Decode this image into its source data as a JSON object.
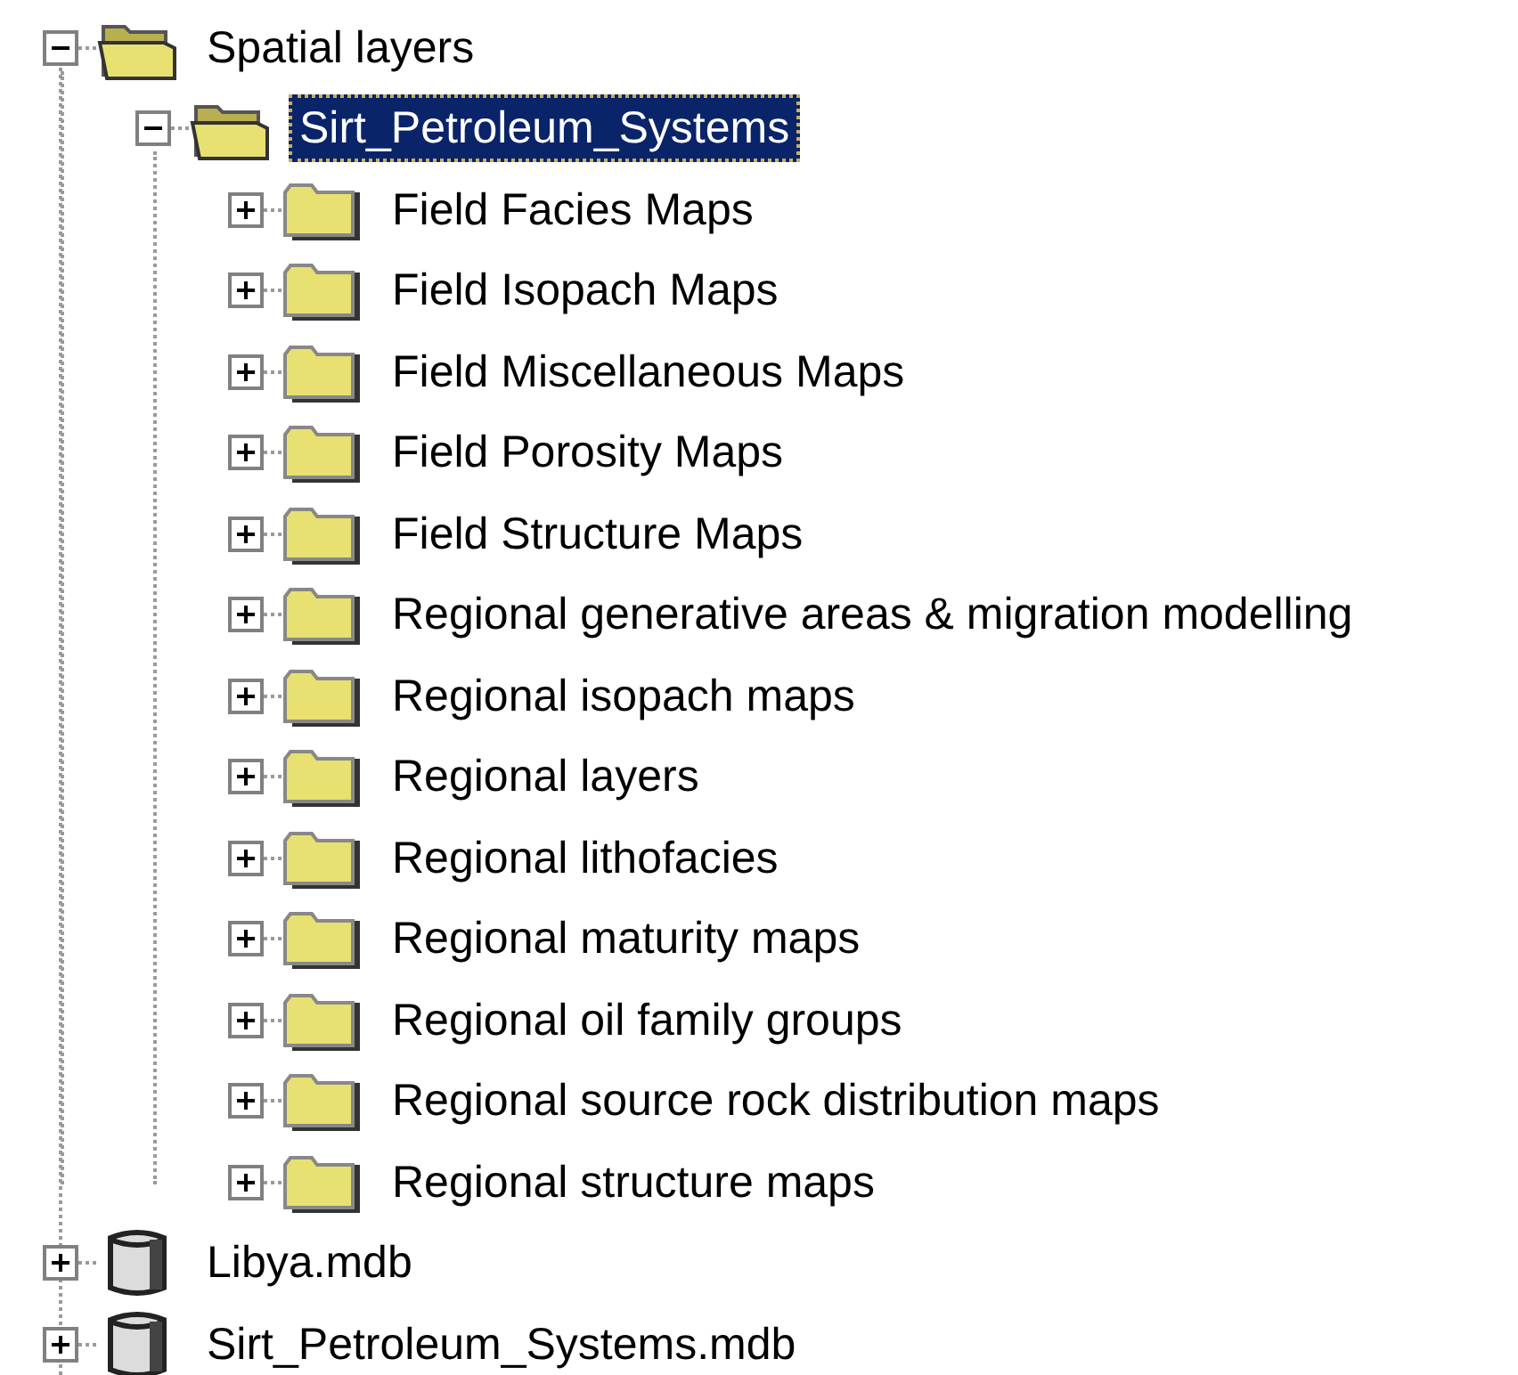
{
  "tree": [
    {
      "label": "Spatial layers",
      "kind": "folder",
      "expanded": true,
      "selected": false,
      "children": [
        {
          "label": "Sirt_Petroleum_Systems",
          "kind": "folder",
          "expanded": true,
          "selected": true,
          "children": [
            {
              "label": "Field Facies Maps",
              "kind": "folder",
              "expanded": false,
              "selected": false
            },
            {
              "label": "Field Isopach Maps",
              "kind": "folder",
              "expanded": false,
              "selected": false
            },
            {
              "label": "Field Miscellaneous Maps",
              "kind": "folder",
              "expanded": false,
              "selected": false
            },
            {
              "label": "Field Porosity Maps",
              "kind": "folder",
              "expanded": false,
              "selected": false
            },
            {
              "label": "Field Structure Maps",
              "kind": "folder",
              "expanded": false,
              "selected": false
            },
            {
              "label": "Regional generative areas & migration modelling",
              "kind": "folder",
              "expanded": false,
              "selected": false
            },
            {
              "label": "Regional isopach maps",
              "kind": "folder",
              "expanded": false,
              "selected": false
            },
            {
              "label": "Regional layers",
              "kind": "folder",
              "expanded": false,
              "selected": false
            },
            {
              "label": "Regional lithofacies",
              "kind": "folder",
              "expanded": false,
              "selected": false
            },
            {
              "label": "Regional maturity maps",
              "kind": "folder",
              "expanded": false,
              "selected": false
            },
            {
              "label": "Regional oil family groups",
              "kind": "folder",
              "expanded": false,
              "selected": false
            },
            {
              "label": "Regional source rock distribution maps",
              "kind": "folder",
              "expanded": false,
              "selected": false
            },
            {
              "label": "Regional structure maps",
              "kind": "folder",
              "expanded": false,
              "selected": false
            }
          ]
        }
      ]
    },
    {
      "label": "Libya.mdb",
      "kind": "database",
      "expanded": false,
      "selected": false
    },
    {
      "label": "Sirt_Petroleum_Systems.mdb",
      "kind": "database",
      "expanded": false,
      "selected": false
    }
  ]
}
